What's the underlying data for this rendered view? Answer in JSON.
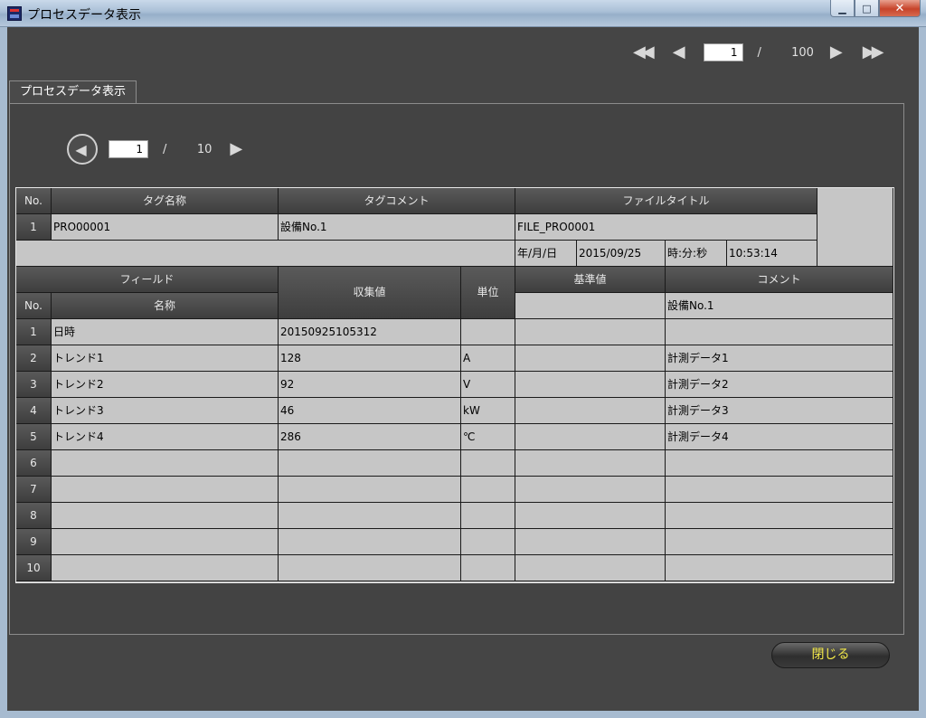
{
  "window": {
    "title": "プロセスデータ表示"
  },
  "top_nav": {
    "current_page": "1",
    "separator": "/",
    "total_pages": "100"
  },
  "tab": {
    "label": "プロセスデータ表示"
  },
  "sub_nav": {
    "current_page": "1",
    "separator": "/",
    "total_pages": "10"
  },
  "tag_section": {
    "header_no": "No.",
    "header_tag_name": "タグ名称",
    "header_tag_comment": "タグコメント",
    "header_file_title": "ファイルタイトル",
    "row_no": "1",
    "tag_name": "PRO00001",
    "tag_comment": "設備No.1",
    "file_title": "FILE_PRO0001",
    "date_label": "年/月/日",
    "date_value": "2015/09/25",
    "time_label": "時:分:秒",
    "time_value": "10:53:14"
  },
  "field_section": {
    "header_field": "フィールド",
    "header_no": "No.",
    "header_name": "名称",
    "header_collected": "収集値",
    "header_unit": "単位",
    "header_reference": "基準値",
    "header_comment": "コメント",
    "header_comment_value": "設備No.1",
    "rows": [
      {
        "no": "1",
        "name": "日時",
        "value": "20150925105312",
        "unit": "",
        "reference": "",
        "comment": ""
      },
      {
        "no": "2",
        "name": "トレンド1",
        "value": "128",
        "unit": "A",
        "reference": "",
        "comment": "計測データ1"
      },
      {
        "no": "3",
        "name": "トレンド2",
        "value": "92",
        "unit": "V",
        "reference": "",
        "comment": "計測データ2"
      },
      {
        "no": "4",
        "name": "トレンド3",
        "value": "46",
        "unit": "kW",
        "reference": "",
        "comment": "計測データ3"
      },
      {
        "no": "5",
        "name": "トレンド4",
        "value": "286",
        "unit": "℃",
        "reference": "",
        "comment": "計測データ4"
      },
      {
        "no": "6",
        "name": "",
        "value": "",
        "unit": "",
        "reference": "",
        "comment": ""
      },
      {
        "no": "7",
        "name": "",
        "value": "",
        "unit": "",
        "reference": "",
        "comment": ""
      },
      {
        "no": "8",
        "name": "",
        "value": "",
        "unit": "",
        "reference": "",
        "comment": ""
      },
      {
        "no": "9",
        "name": "",
        "value": "",
        "unit": "",
        "reference": "",
        "comment": ""
      },
      {
        "no": "10",
        "name": "",
        "value": "",
        "unit": "",
        "reference": "",
        "comment": ""
      }
    ]
  },
  "footer": {
    "close_label": "閉じる"
  }
}
